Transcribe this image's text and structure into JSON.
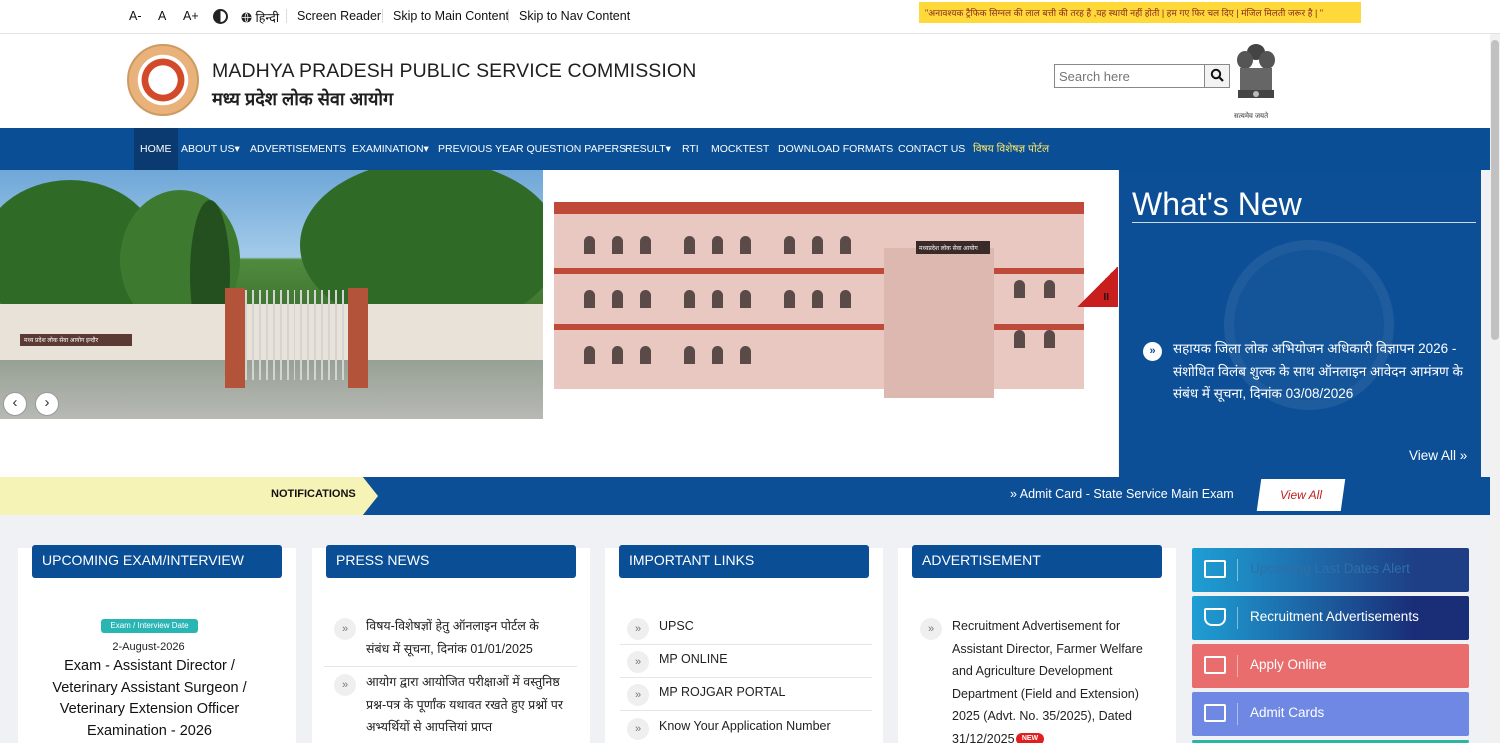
{
  "accessibility": {
    "font_decrease": "A-",
    "font_normal": "A",
    "font_increase": "A+",
    "language": "हिन्दी",
    "screen_reader": "Screen Reader",
    "skip_main": "Skip to Main Content",
    "skip_nav": "Skip to Nav Content",
    "ticker": "\"अनावश्यक ट्रैफिक सिग्नल की लाल बत्ती की तरह है ,यह स्थायी नहीं होती | हम गए फिर चल दिए | मंजिल मिलती जरूर है | \""
  },
  "header": {
    "org_name_en": "MADHYA PRADESH PUBLIC SERVICE COMMISSION",
    "org_name_hi": "मध्य प्रदेश लोक सेवा आयोग",
    "search_placeholder": "Search here",
    "emblem_caption": "सत्यमेव जयते"
  },
  "nav": {
    "items": [
      "HOME",
      "ABOUT US▾",
      "ADVERTISEMENTS",
      "EXAMINATION▾",
      "PREVIOUS YEAR QUESTION PAPERS",
      "RESULT▾",
      "RTI",
      "MOCKTEST",
      "DOWNLOAD FORMATS",
      "CONTACT US",
      "विषय विशेषज्ञ पोर्टल"
    ]
  },
  "hero": {
    "gate_sign": "मध्य प्रदेश लोक सेवा आयोग इन्दौर",
    "building_sign": "मध्यप्रदेश लोक सेवा आयोग",
    "prev": "‹",
    "next": "›",
    "pause": "II"
  },
  "whats_new": {
    "title": "What's New",
    "item": "सहायक जिला लोक अभियोजन अधिकारी विज्ञापन 2026 - संशोधित विलंब शुल्क के साथ ऑनलाइन आवेदन आमंत्रण के संबंध में सूचना, दिनांक 03/08/2026",
    "view_all": "View All »"
  },
  "notifications": {
    "label": "NOTIFICATIONS",
    "text": "» Admit Card - State Service Main Exam",
    "view_all": "View All"
  },
  "cards": {
    "upcoming": {
      "title": "UPCOMING EXAM/INTERVIEW",
      "badge": "Exam / Interview Date",
      "date": "2-August-2026",
      "exam": "Exam - Assistant Director / Veterinary Assistant Surgeon / Veterinary Extension Officer Examination - 2026"
    },
    "press": {
      "title": "PRESS NEWS",
      "items": [
        "विषय-विशेषज्ञों हेतु ऑनलाइन पोर्टल के संबंध में सूचना, दिनांक 01/01/2025",
        "आयोग द्वारा आयोजित परीक्षाओं में वस्तुनिष्ठ प्रश्न-पत्र के पूर्णांक यथावत रखते हुए प्रश्नों पर अभ्यर्थियों से आपत्तियां प्राप्त"
      ]
    },
    "links": {
      "title": "IMPORTANT LINKS",
      "items": [
        "UPSC",
        "MP ONLINE",
        "MP ROJGAR PORTAL",
        "Know Your Application Number"
      ]
    },
    "advertisement": {
      "title": "ADVERTISEMENT",
      "item": "Recruitment Advertisement for Assistant Director, Farmer Welfare and Agriculture Development Department (Field and Extension) 2025 (Advt. No. 35/2025), Dated 31/12/2025",
      "new_badge": "NEW"
    }
  },
  "actions": [
    {
      "label": "Upcoming Last Dates Alert",
      "color": "#1e3f86"
    },
    {
      "label": "Recruitment Advertisements",
      "color": "#1a2e78"
    },
    {
      "label": "Apply Online",
      "color": "#e96d6d"
    },
    {
      "label": "Admit Cards",
      "color": "#6f88e4"
    }
  ],
  "icons": {
    "bullet": "»",
    "search": "search-icon",
    "globe": "globe-icon",
    "contrast": "contrast-icon"
  }
}
